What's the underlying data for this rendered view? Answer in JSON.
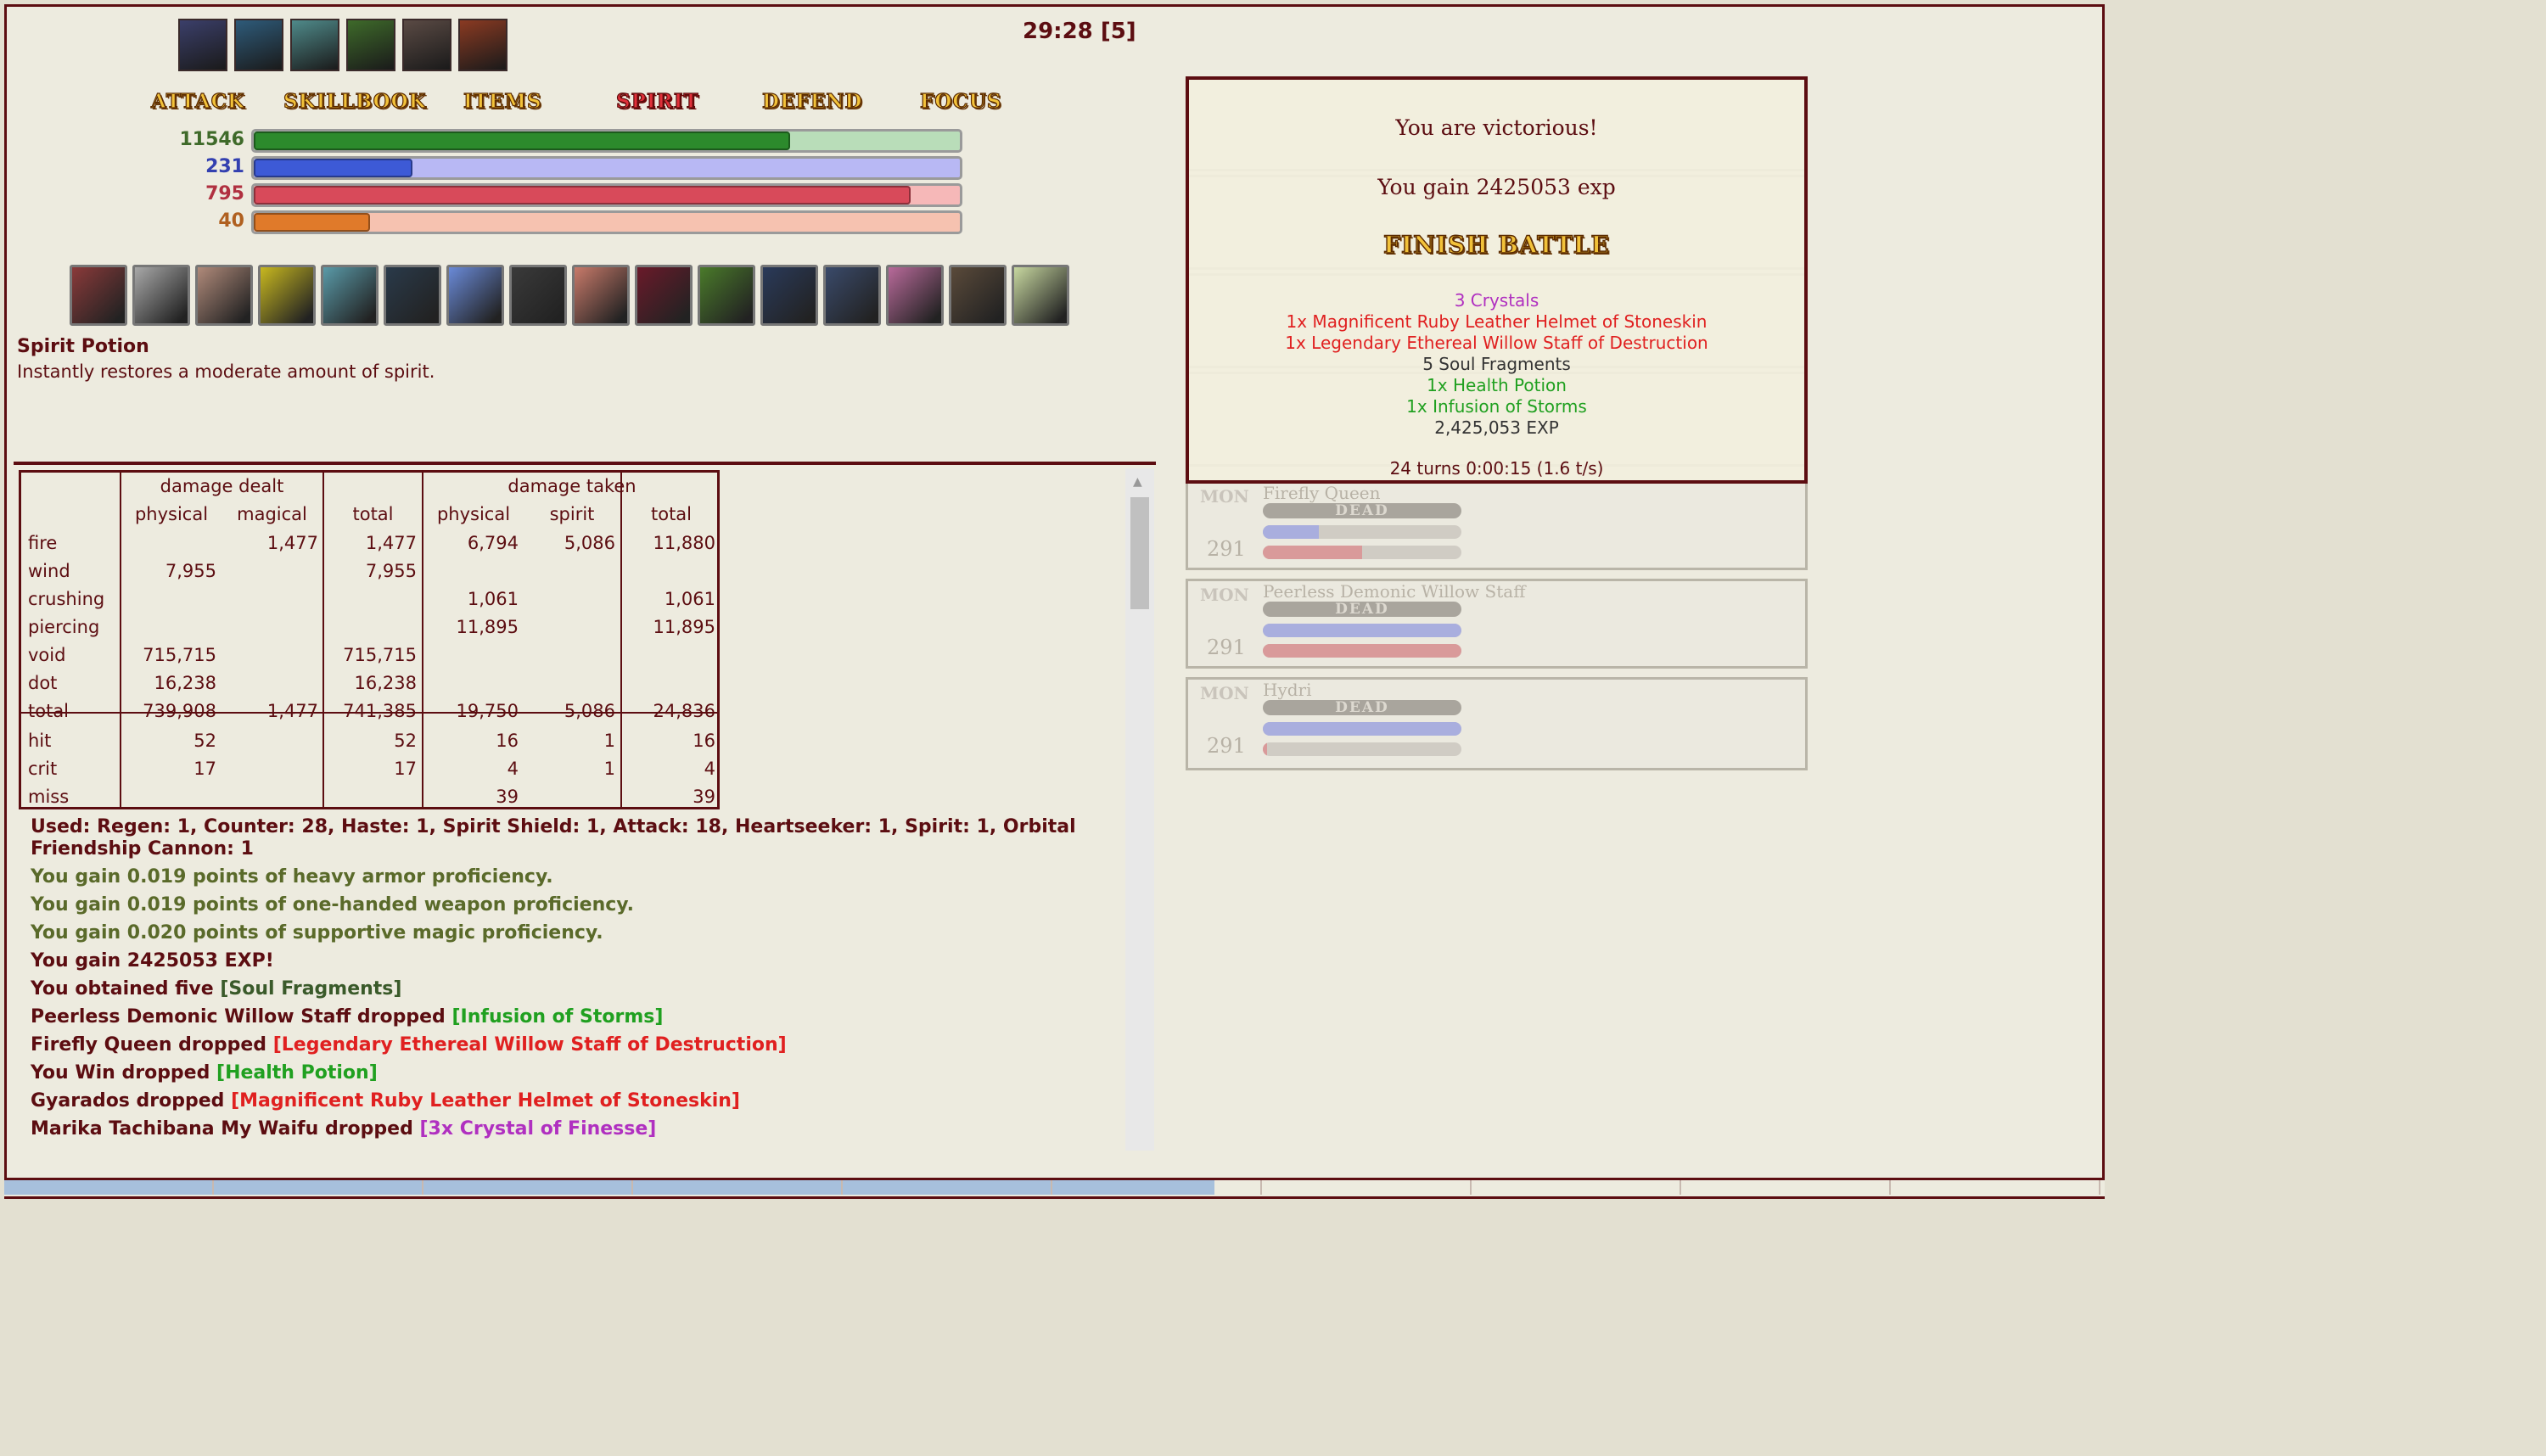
{
  "timer": "29:28 [5]",
  "party_portraits": [
    {
      "name": "portrait-1",
      "color": "#3b3f6a"
    },
    {
      "name": "portrait-2",
      "color": "#2e5b7a"
    },
    {
      "name": "portrait-3",
      "color": "#4f8a8a"
    },
    {
      "name": "portrait-4",
      "color": "#3e6a2a"
    },
    {
      "name": "portrait-5",
      "color": "#5a4a44"
    },
    {
      "name": "portrait-6",
      "color": "#8a3a22"
    }
  ],
  "commands": {
    "attack": "ATTACK",
    "skillbook": "SKILLBOOK",
    "items": "ITEMS",
    "spirit": "SPIRIT",
    "defend": "DEFEND",
    "focus": "FOCUS"
  },
  "bars": {
    "health": {
      "value": "11546",
      "fraction": 0.76,
      "color": "#2c8a2c",
      "track": "#b9ddb9"
    },
    "magic": {
      "value": "231",
      "fraction": 0.225,
      "color": "#3d5ad6",
      "track": "#b8b8f4"
    },
    "spirit": {
      "value": "795",
      "fraction": 0.93,
      "color": "#d84a5a",
      "track": "#f6b8b8"
    },
    "overcharge": {
      "value": "40",
      "fraction": 0.165,
      "color": "#e07a2a",
      "track": "#f6c2b0"
    }
  },
  "quickbar": [
    {
      "color": "#8a3a3a"
    },
    {
      "color": "#a8a8a8"
    },
    {
      "color": "#b08a7a"
    },
    {
      "color": "#c8b820"
    },
    {
      "color": "#5a9aa8"
    },
    {
      "color": "#2a3a4a"
    },
    {
      "color": "#6a8ad8"
    },
    {
      "color": "#3a3a3a"
    },
    {
      "color": "#c87a6a"
    },
    {
      "color": "#6a1a2a"
    },
    {
      "color": "#4a7a2a"
    },
    {
      "color": "#2a3a5a"
    },
    {
      "color": "#3a4a6a"
    },
    {
      "color": "#b86a9a"
    },
    {
      "color": "#5a4a3a"
    },
    {
      "color": "#c8d8a0"
    }
  ],
  "selected_item": {
    "name": "Spirit Potion",
    "description": "Instantly restores a moderate amount of spirit."
  },
  "stats": {
    "group_dealt": "damage dealt",
    "group_taken": "damage taken",
    "columns": [
      "physical",
      "magical",
      "total",
      "physical",
      "spirit",
      "total"
    ],
    "rows": [
      {
        "label": "fire",
        "cells": [
          "",
          "1,477",
          "1,477",
          "6,794",
          "5,086",
          "11,880"
        ]
      },
      {
        "label": "wind",
        "cells": [
          "7,955",
          "",
          "7,955",
          "",
          "",
          ""
        ]
      },
      {
        "label": "crushing",
        "cells": [
          "",
          "",
          "",
          "1,061",
          "",
          "1,061"
        ]
      },
      {
        "label": "piercing",
        "cells": [
          "",
          "",
          "",
          "11,895",
          "",
          "11,895"
        ]
      },
      {
        "label": "void",
        "cells": [
          "715,715",
          "",
          "715,715",
          "",
          "",
          ""
        ]
      },
      {
        "label": "dot",
        "cells": [
          "16,238",
          "",
          "16,238",
          "",
          "",
          ""
        ]
      },
      {
        "label": "total",
        "cells": [
          "739,908",
          "1,477",
          "741,385",
          "19,750",
          "5,086",
          "24,836"
        ]
      },
      {
        "label": "hit",
        "cells": [
          "52",
          "",
          "52",
          "16",
          "1",
          "16"
        ]
      },
      {
        "label": "crit",
        "cells": [
          "17",
          "",
          "17",
          "4",
          "1",
          "4"
        ]
      },
      {
        "label": "miss",
        "cells": [
          "",
          "",
          "",
          "39",
          "",
          "39"
        ]
      }
    ]
  },
  "log": {
    "used": "Used: Regen: 1, Counter: 28, Haste: 1, Spirit Shield: 1, Attack: 18, Heartseeker: 1, Spirit: 1, Orbital",
    "used_cont": "Friendship Cannon: 1",
    "prof1": "You gain 0.019 points of heavy armor proficiency.",
    "prof2": "You gain 0.019 points of one-handed weapon proficiency.",
    "prof3": "You gain 0.020 points of supportive magic proficiency.",
    "exp": "You gain 2425053 EXP!",
    "obtained_prefix": "You obtained five ",
    "obtained_item": "[Soul Fragments]",
    "drop1_prefix": "Peerless Demonic Willow Staff dropped ",
    "drop1_item": "[Infusion of Storms]",
    "drop2_prefix": "Firefly Queen dropped ",
    "drop2_item": "[Legendary Ethereal Willow Staff of Destruction]",
    "drop3_prefix": "You Win dropped ",
    "drop3_item": "[Health Potion]",
    "drop4_prefix": "Gyarados dropped ",
    "drop4_item": "[Magnificent Ruby Leather Helmet of Stoneskin]",
    "drop5_prefix": "Marika Tachibana My Waifu dropped ",
    "drop5_item": "[3x Crystal of Finesse]"
  },
  "victory": {
    "message": "You are victorious!",
    "exp_message": "You gain 2425053 exp",
    "finish_label": "FINISH BATTLE",
    "loot": [
      {
        "text": "3 Crystals",
        "color": "#b030c0"
      },
      {
        "text": "1x Magnificent Ruby Leather Helmet of Stoneskin",
        "color": "#e02020"
      },
      {
        "text": "1x Legendary Ethereal Willow Staff of Destruction",
        "color": "#e02020"
      },
      {
        "text": "5 Soul Fragments",
        "color": "#333333"
      },
      {
        "text": "1x Health Potion",
        "color": "#20a020"
      },
      {
        "text": "1x Infusion of Storms",
        "color": "#20a020"
      },
      {
        "text": "2,425,053 EXP",
        "color": "#333333"
      }
    ],
    "summary": "24 turns 0:00:15 (1.6 t/s)"
  },
  "monsters": [
    {
      "label": "MON",
      "name": "Firefly Queen",
      "level": "291",
      "status": "DEAD",
      "mp_fraction": 0.28,
      "sp_fraction": 0.5
    },
    {
      "label": "MON",
      "name": "Peerless Demonic Willow Staff",
      "level": "291",
      "status": "DEAD",
      "mp_fraction": 1.0,
      "sp_fraction": 1.0
    },
    {
      "label": "MON",
      "name": "Hydri",
      "level": "291",
      "status": "DEAD",
      "mp_fraction": 1.0,
      "sp_fraction": 0.02
    }
  ],
  "colors": {
    "accent": "#5c0d11",
    "prof": "#5a6a2a",
    "item_green": "#20a020",
    "item_red": "#e02020",
    "item_purple": "#b030c0"
  }
}
